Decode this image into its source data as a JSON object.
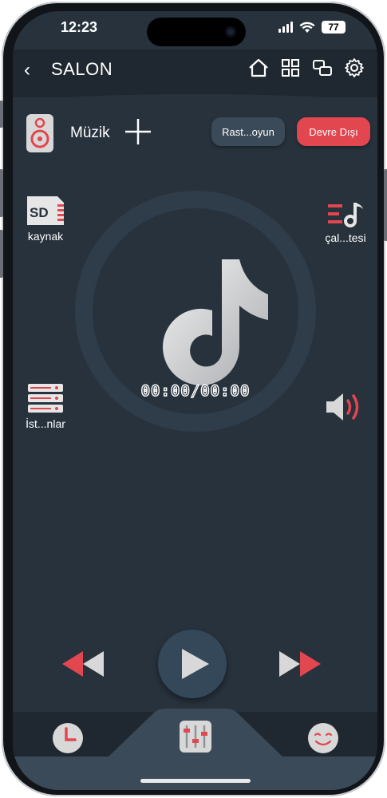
{
  "status_bar": {
    "time": "12:23",
    "battery": "77"
  },
  "header": {
    "back_glyph": "‹",
    "title": "SALON",
    "icons": [
      "home-icon",
      "grid-icon",
      "rooms-icon",
      "settings-icon"
    ]
  },
  "music": {
    "label": "Müzik",
    "shuffle_label": "Rast...oyun",
    "disabled_label": "Devre Dışı"
  },
  "left_items": [
    {
      "label": "kaynak",
      "icon": "sd-card-icon"
    },
    {
      "label": "İst...nlar",
      "icon": "stations-icon"
    }
  ],
  "right_items": [
    {
      "label": "çal...tesi",
      "icon": "playlist-icon"
    },
    {
      "label": "",
      "icon": "volume-icon"
    }
  ],
  "player": {
    "time": "00:00/00:00"
  },
  "tabs": [
    "clock-icon",
    "equalizer-icon",
    "smiley-icon"
  ],
  "colors": {
    "background": "#27323d",
    "header": "#1f2830",
    "accent_red": "#e2464f",
    "button_dark": "#3b4a59"
  }
}
